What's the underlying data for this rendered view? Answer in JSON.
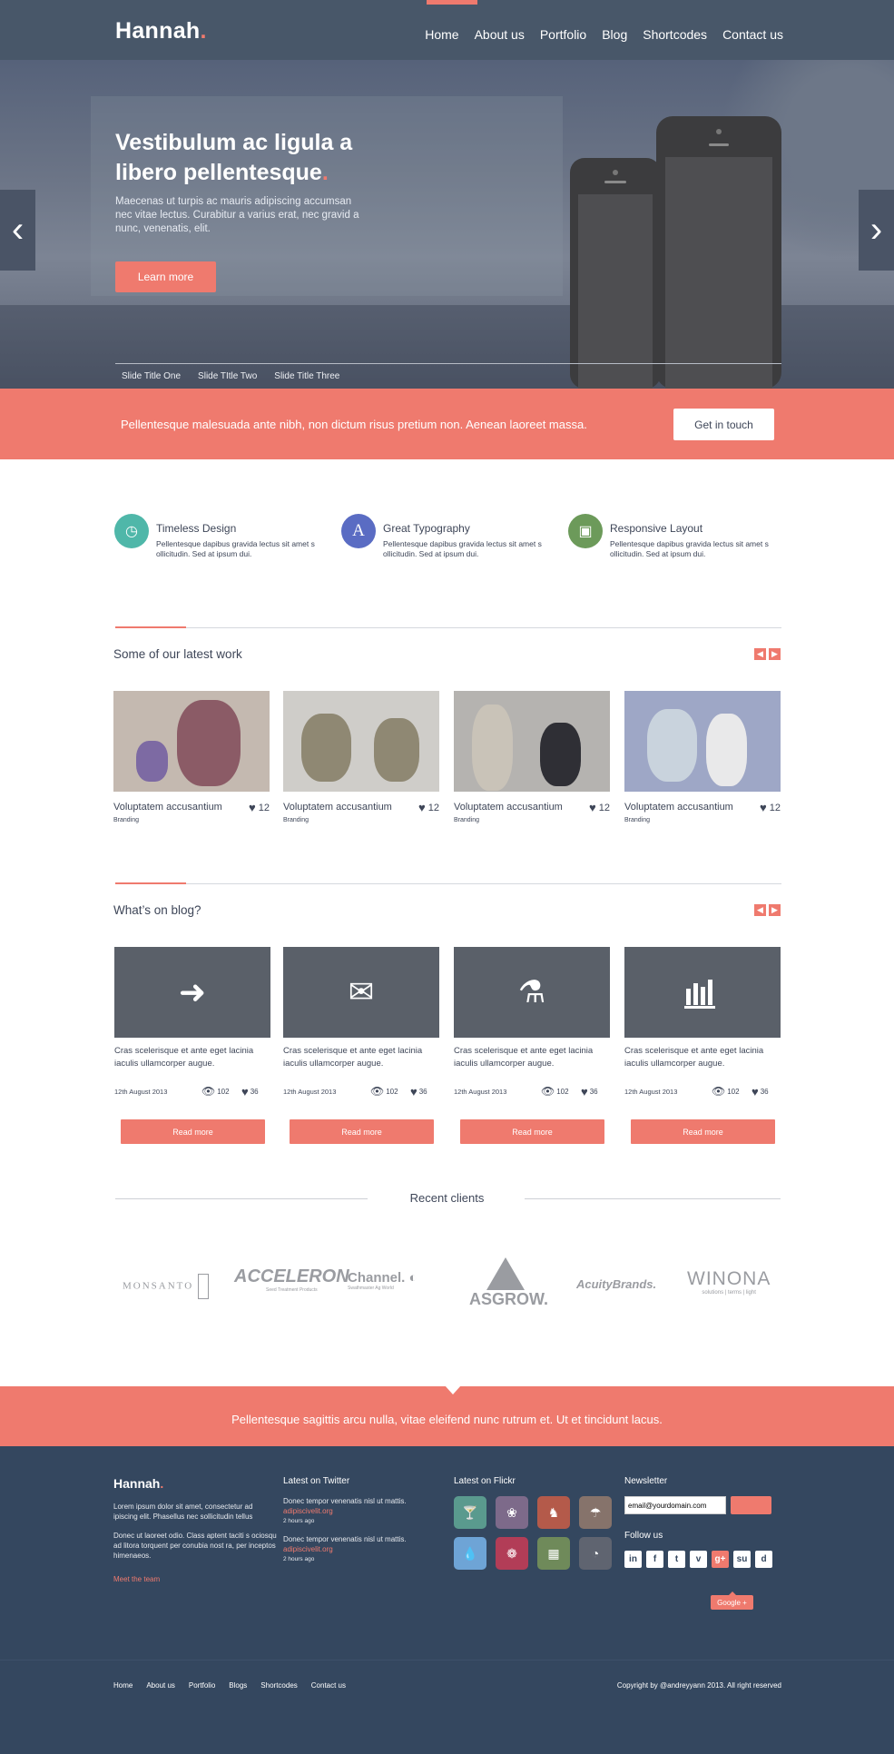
{
  "header": {
    "logo": "Hannah",
    "logo_dot": ".",
    "nav": [
      "Home",
      "About us",
      "Portfolio",
      "Blog",
      "Shortcodes",
      "Contact us"
    ]
  },
  "hero": {
    "title_line1": "Vestibulum ac ligula a",
    "title_line2": "libero pellentesque",
    "title_dot": ".",
    "subtitle": "Maecenas ut turpis ac mauris adipiscing accumsan nec vitae lectus. Curabitur a varius erat, nec gravid a nunc, venenatis, elit.",
    "cta": "Learn more",
    "slide_titles": [
      "Slide Title One",
      "Slide TItle Two",
      "Slide Title Three"
    ],
    "prev_icon": "chevron-left-icon",
    "next_icon": "chevron-right-icon"
  },
  "cta_bar": {
    "text": "Pellentesque malesuada ante nibh, non dictum risus pretium non. Aenean laoreet massa.",
    "button": "Get in touch"
  },
  "features": [
    {
      "title": "Timeless Design",
      "text": "Pellentesque dapibus gravida lectus sit amet s ollicitudin. Sed at ipsum dui.",
      "icon": "clock-icon",
      "color": "#4fb7a9"
    },
    {
      "title": "Great Typography",
      "text": "Pellentesque dapibus gravida lectus sit amet s ollicitudin. Sed at ipsum dui.",
      "icon": "typography-icon",
      "color": "#5a6cc3"
    },
    {
      "title": "Responsive Layout",
      "text": "Pellentesque dapibus gravida lectus sit amet s ollicitudin. Sed at ipsum dui.",
      "icon": "devices-icon",
      "color": "#6c9a5a"
    }
  ],
  "work": {
    "heading": "Some of our latest work",
    "items": [
      {
        "title": "Voluptatem accusantium",
        "category": "Branding",
        "likes": "12"
      },
      {
        "title": "Voluptatem accusantium",
        "category": "Branding",
        "likes": "12"
      },
      {
        "title": "Voluptatem accusantium",
        "category": "Branding",
        "likes": "12"
      },
      {
        "title": "Voluptatem accusantium",
        "category": "Branding",
        "likes": "12"
      }
    ]
  },
  "blog": {
    "heading": "What’s on blog?",
    "items": [
      {
        "icon": "tag-icon",
        "excerpt": "Cras scelerisque et ante eget lacinia iaculis ullamcorper augue.",
        "date": "12th August 2013",
        "views": "102",
        "likes": "36",
        "button": "Read more"
      },
      {
        "icon": "mail-icon",
        "excerpt": "Cras scelerisque et ante eget lacinia iaculis ullamcorper augue.",
        "date": "12th August 2013",
        "views": "102",
        "likes": "36",
        "button": "Read more"
      },
      {
        "icon": "flask-icon",
        "excerpt": "Cras scelerisque et ante eget lacinia iaculis ullamcorper augue.",
        "date": "12th August 2013",
        "views": "102",
        "likes": "36",
        "button": "Read more"
      },
      {
        "icon": "bar-chart-icon",
        "excerpt": "Cras scelerisque et ante eget lacinia iaculis ullamcorper augue.",
        "date": "12th August 2013",
        "views": "102",
        "likes": "36",
        "button": "Read more"
      }
    ]
  },
  "clients": {
    "heading": "Recent clients",
    "logos": [
      "MONSANTO",
      "ACCELERON",
      "Channel.",
      "ASGROW.",
      "AcuityBrands.",
      "WINONA"
    ],
    "sublines": [
      "",
      "Seed Treatment Products",
      "Swathmaster Ag World",
      "",
      "",
      "solutions | terms | light"
    ]
  },
  "band": {
    "text": "Pellentesque sagittis arcu nulla, vitae eleifend nunc rutrum et. Ut et tincidunt lacus."
  },
  "footer": {
    "logo": "Hannah",
    "logo_dot": ".",
    "about_p1": "Lorem ipsum dolor sit amet, consectetur ad ipiscing elit. Phasellus nec sollicitudin tellus",
    "about_p2": "Donec ut laoreet odio. Class aptent taciti s ociosqu ad litora torquent per conubia nost ra, per inceptos himenaeos.",
    "meet_team": "Meet the team",
    "twitter_heading": "Latest on Twitter",
    "tweets": [
      {
        "text": "Donec tempor venenatis nisl ut mattis.",
        "link": "adipiscivelit.org",
        "ago": "2 hours ago"
      },
      {
        "text": "Donec tempor venenatis nisl ut mattis.",
        "link": "adipiscivelit.org",
        "ago": "2 hours ago"
      }
    ],
    "flickr_heading": "Latest on Flickr",
    "flickr": [
      {
        "icon": "cocktail-icon",
        "color": "#5a9a8e"
      },
      {
        "icon": "leaf-icon",
        "color": "#7d6a8a"
      },
      {
        "icon": "horse-icon",
        "color": "#b45a4a"
      },
      {
        "icon": "umbrella-icon",
        "color": "#86736b"
      },
      {
        "icon": "drops-icon",
        "color": "#6ea4d6"
      },
      {
        "icon": "pinwheel-icon",
        "color": "#b23d57"
      },
      {
        "icon": "gift-icon",
        "color": "#6f8a5a"
      },
      {
        "icon": "chart-icon",
        "color": "#5f6470"
      }
    ],
    "newsletter_heading": "Newsletter",
    "email_value": "email@yourdomain.com",
    "follow_heading": "Follow us",
    "social": [
      "in",
      "f",
      "t",
      "v",
      "g+",
      "su",
      "d"
    ],
    "social_icons": [
      "linkedin-icon",
      "facebook-icon",
      "twitter-icon",
      "vimeo-icon",
      "google-plus-icon",
      "stumbleupon-icon",
      "dribbble-icon"
    ],
    "tooltip": "Google +",
    "nav": [
      "Home",
      "About us",
      "Portfolio",
      "Blogs",
      "Shortcodes",
      "Contact us"
    ],
    "copyright": "Copyright by @andreyyann 2013. All right reserved"
  },
  "colors": {
    "accent": "#ef7a6e",
    "header": "#485769",
    "footer": "#34475f"
  }
}
